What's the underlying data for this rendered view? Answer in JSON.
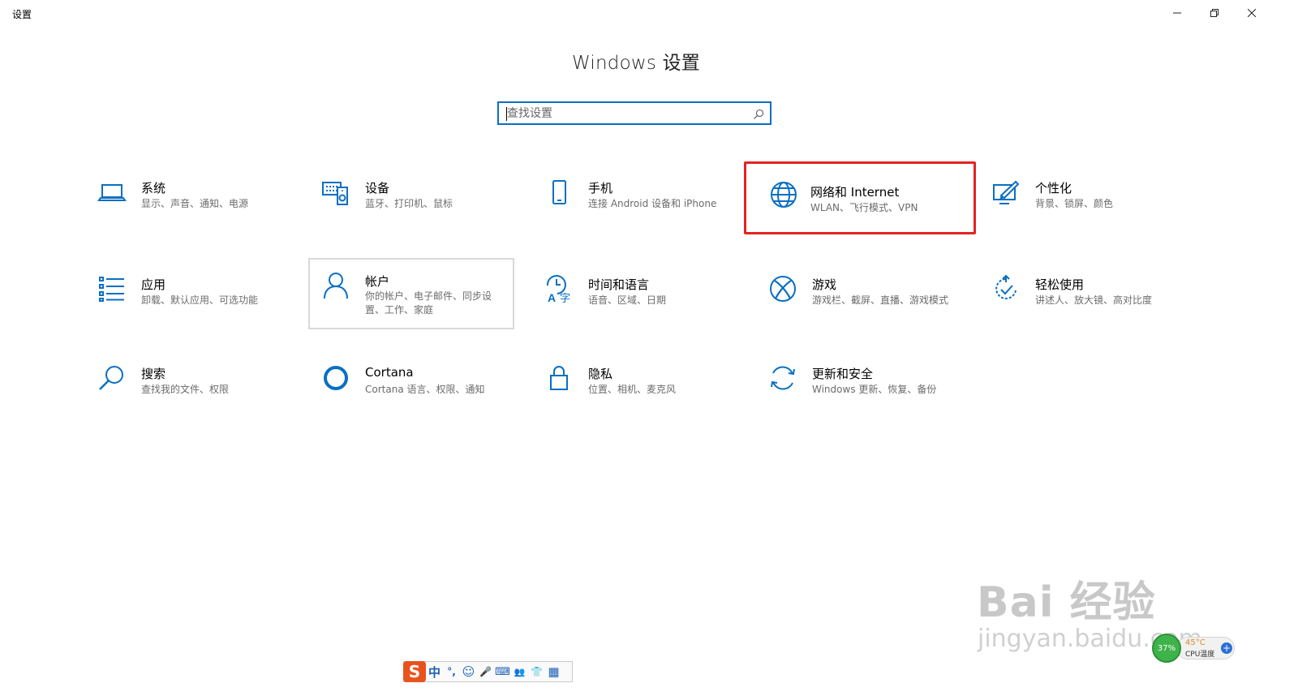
{
  "window": {
    "title": "设置",
    "minimize_icon": "minimize-icon",
    "restore_icon": "restore-icon",
    "close_icon": "close-icon"
  },
  "header": {
    "title": "Windows 设置"
  },
  "search": {
    "placeholder": "查找设置",
    "value": "",
    "icon": "search-icon",
    "accent": "#0a6fc2"
  },
  "tiles": [
    {
      "icon": "laptop-icon",
      "title": "系统",
      "desc": "显示、声音、通知、电源"
    },
    {
      "icon": "keyboard-speaker-icon",
      "title": "设备",
      "desc": "蓝牙、打印机、鼠标"
    },
    {
      "icon": "phone-icon",
      "title": "手机",
      "desc": "连接 Android 设备和 iPhone"
    },
    {
      "icon": "globe-icon",
      "title": "网络和 Internet",
      "desc": "WLAN、飞行模式、VPN",
      "highlighted": true
    },
    {
      "icon": "paintbrush-icon",
      "title": "个性化",
      "desc": "背景、锁屏、颜色"
    },
    {
      "icon": "apps-list-icon",
      "title": "应用",
      "desc": "卸载、默认应用、可选功能"
    },
    {
      "icon": "person-icon",
      "title": "帐户",
      "desc": "你的帐户、电子邮件、同步设置、工作、家庭",
      "hovered": true
    },
    {
      "icon": "time-language-icon",
      "title": "时间和语言",
      "desc": "语音、区域、日期"
    },
    {
      "icon": "xbox-icon",
      "title": "游戏",
      "desc": "游戏栏、截屏、直播、游戏模式"
    },
    {
      "icon": "ease-of-access-icon",
      "title": "轻松使用",
      "desc": "讲述人、放大镜、高对比度"
    },
    {
      "icon": "search-magnifier-icon",
      "title": "搜索",
      "desc": "查找我的文件、权限"
    },
    {
      "icon": "cortana-ring-icon",
      "title": "Cortana",
      "desc": "Cortana 语言、权限、通知"
    },
    {
      "icon": "lock-icon",
      "title": "隐私",
      "desc": "位置、相机、麦克风"
    },
    {
      "icon": "sync-icon",
      "title": "更新和安全",
      "desc": "Windows 更新、恢复、备份"
    }
  ],
  "colors": {
    "accent_blue": "#0a6fc2",
    "highlight_red": "#e32323"
  },
  "ime_toolbar": {
    "logo": "S",
    "items": [
      "中",
      "°,",
      "☺",
      "🎤",
      "⌨",
      "👥",
      "👕",
      "▦"
    ]
  },
  "watermark": {
    "brand": "Bai 经验",
    "url": "jingyan.baidu.com"
  },
  "cpu_widget": {
    "percent": "37%",
    "temp": "45°C",
    "label": "CPU温度",
    "plus": "+"
  }
}
